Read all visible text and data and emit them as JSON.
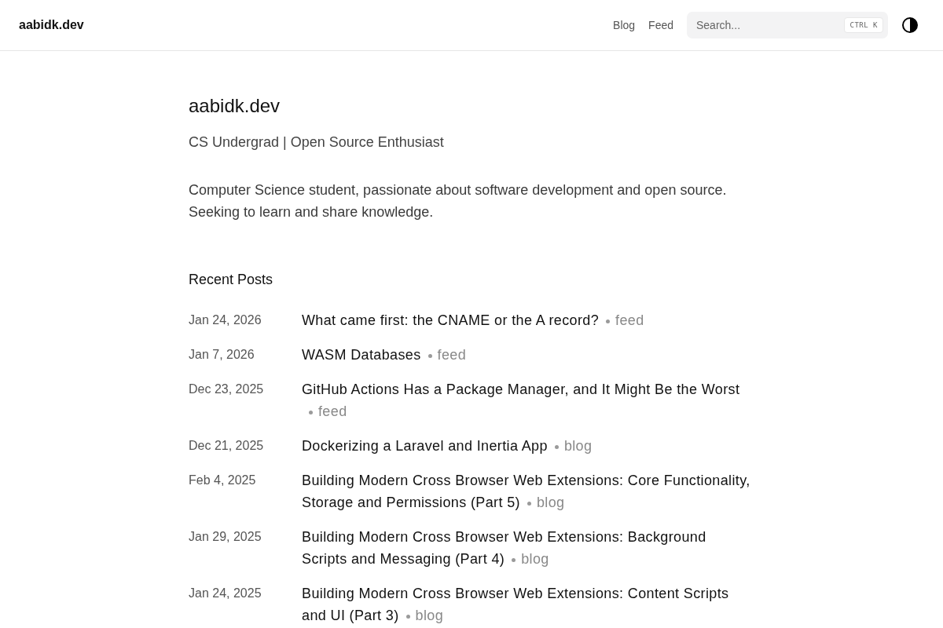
{
  "header": {
    "logo": "aabidk.dev",
    "nav": [
      {
        "label": "Blog"
      },
      {
        "label": "Feed"
      }
    ],
    "search": {
      "placeholder": "Search...",
      "shortcut": "CTRL K"
    }
  },
  "profile": {
    "name": "aabidk.dev",
    "tagline": "CS Undergrad | Open Source Enthusiast",
    "bio": "Computer Science student, passionate about software development and open source. Seeking to learn and share knowledge."
  },
  "recent_posts": {
    "heading": "Recent Posts",
    "posts": [
      {
        "date": "Jan 24, 2026",
        "title": "What came first: the CNAME or the A record?",
        "source": "feed"
      },
      {
        "date": "Jan 7, 2026",
        "title": "WASM Databases",
        "source": "feed"
      },
      {
        "date": "Dec 23, 2025",
        "title": "GitHub Actions Has a Package Manager, and It Might Be the Worst",
        "source": "feed"
      },
      {
        "date": "Dec 21, 2025",
        "title": "Dockerizing a Laravel and Inertia App",
        "source": "blog"
      },
      {
        "date": "Feb 4, 2025",
        "title": "Building Modern Cross Browser Web Extensions: Core Functionality, Storage and Permissions (Part 5)",
        "source": "blog"
      },
      {
        "date": "Jan 29, 2025",
        "title": "Building Modern Cross Browser Web Extensions: Background Scripts and Messaging (Part 4)",
        "source": "blog"
      },
      {
        "date": "Jan 24, 2025",
        "title": "Building Modern Cross Browser Web Extensions: Content Scripts and UI (Part 3)",
        "source": "blog"
      }
    ]
  }
}
